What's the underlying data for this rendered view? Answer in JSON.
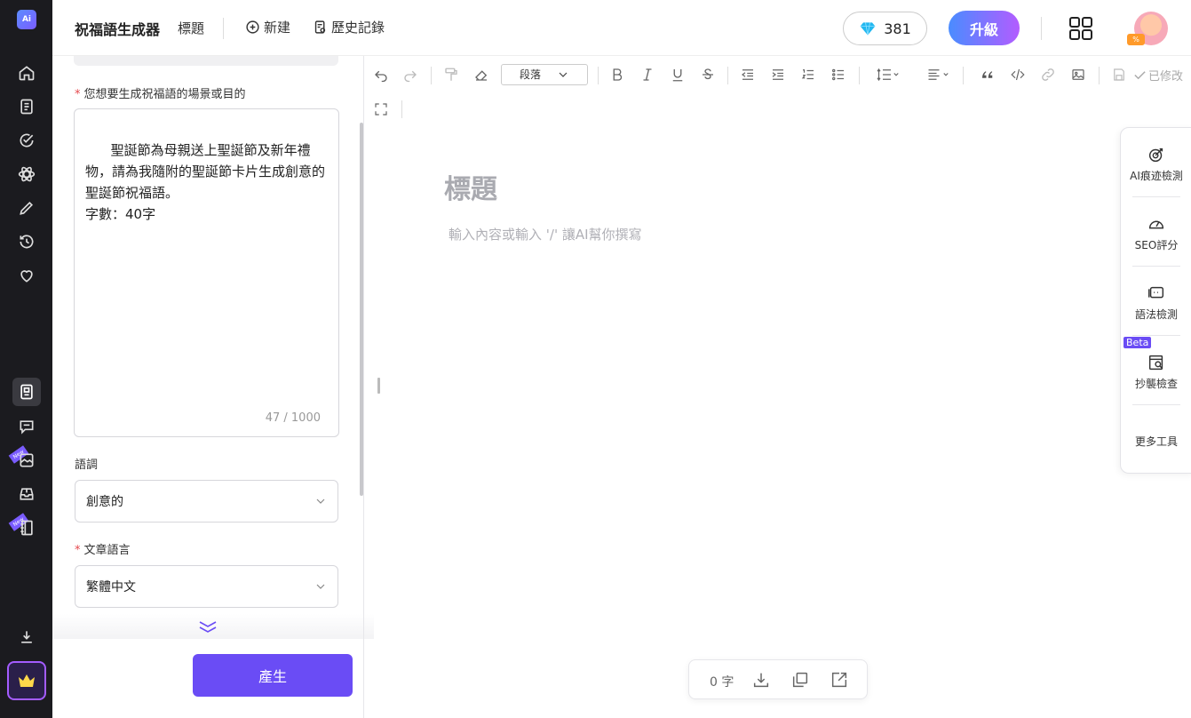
{
  "app": {
    "logo_text": "Ai"
  },
  "rail": {
    "top_items": [
      "home-icon",
      "document-icon",
      "check-circle-icon",
      "atom-icon",
      "pen-icon",
      "history-icon",
      "heart-icon"
    ],
    "bottom_items": [
      "doc-edit-icon",
      "chat-icon",
      "image-icon",
      "inbox-icon",
      "notebook-icon"
    ],
    "new_badge": "New"
  },
  "header": {
    "title": "祝福語生成器",
    "subtitle": "標題",
    "new_label": "新建",
    "history_label": "歷史記錄",
    "credits": "381",
    "upgrade_label": "升級",
    "avatar_badge": "%"
  },
  "form": {
    "purpose_label": "您想要生成祝福語的場景或目的",
    "purpose_text": "聖誕節為母親送上聖誕節及新年禮物，請為我隨附的聖誕節卡片生成創意的聖誕節祝福語。\n字數：40字",
    "purpose_counter": "47 / 1000",
    "tone_label": "語調",
    "tone_value": "創意的",
    "language_label": "文章語言",
    "language_value": "繁體中文",
    "generate_label": "產生"
  },
  "editor": {
    "paragraph_select": "段落",
    "modified_label": "已修改",
    "title_placeholder": "標題",
    "body_placeholder": "輸入內容或輸入 '/' 讓AI幫你撰寫"
  },
  "tools": {
    "items": [
      {
        "label": "AI痕迹檢測",
        "icon": "target-icon"
      },
      {
        "label": "SEO評分",
        "icon": "gauge-icon"
      },
      {
        "label": "語法檢測",
        "icon": "grammar-icon"
      },
      {
        "label": "抄襲檢查",
        "icon": "plagiarism-icon"
      }
    ],
    "beta_badge": "Beta",
    "more_label": "更多工具"
  },
  "stats": {
    "word_count": "0 字"
  }
}
